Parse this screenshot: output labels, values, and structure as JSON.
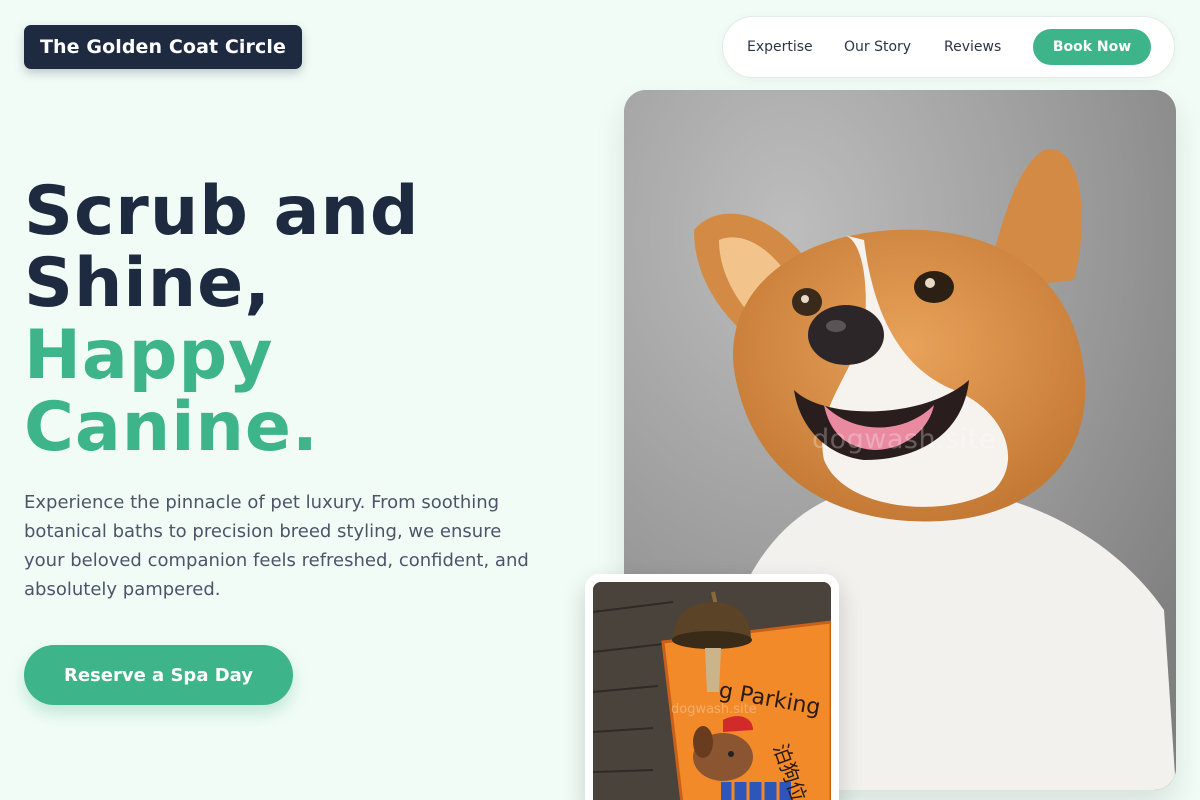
{
  "brand": {
    "name": "The Golden Coat Circle"
  },
  "nav": {
    "links": [
      "Expertise",
      "Our Story",
      "Reviews"
    ],
    "book_label": "Book Now"
  },
  "hero": {
    "title_line1": "Scrub and",
    "title_line2": "Shine,",
    "title_line3": "Happy",
    "title_line4": "Canine.",
    "description": "Experience the pinnacle of pet luxury. From soothing botanical baths to precision breed styling, we ensure your beloved companion feels refreshed, confident, and absolutely pampered.",
    "cta_label": "Reserve a Spa Day"
  },
  "photos": {
    "main_watermark": "dogwash.site",
    "sub_watermark": "dogwash.site",
    "sign_text": "g Parking",
    "sign_text_cjk": "泊狗位"
  },
  "colors": {
    "accent": "#3db489",
    "dark": "#1e2a40",
    "background": "#f2fcf7"
  }
}
